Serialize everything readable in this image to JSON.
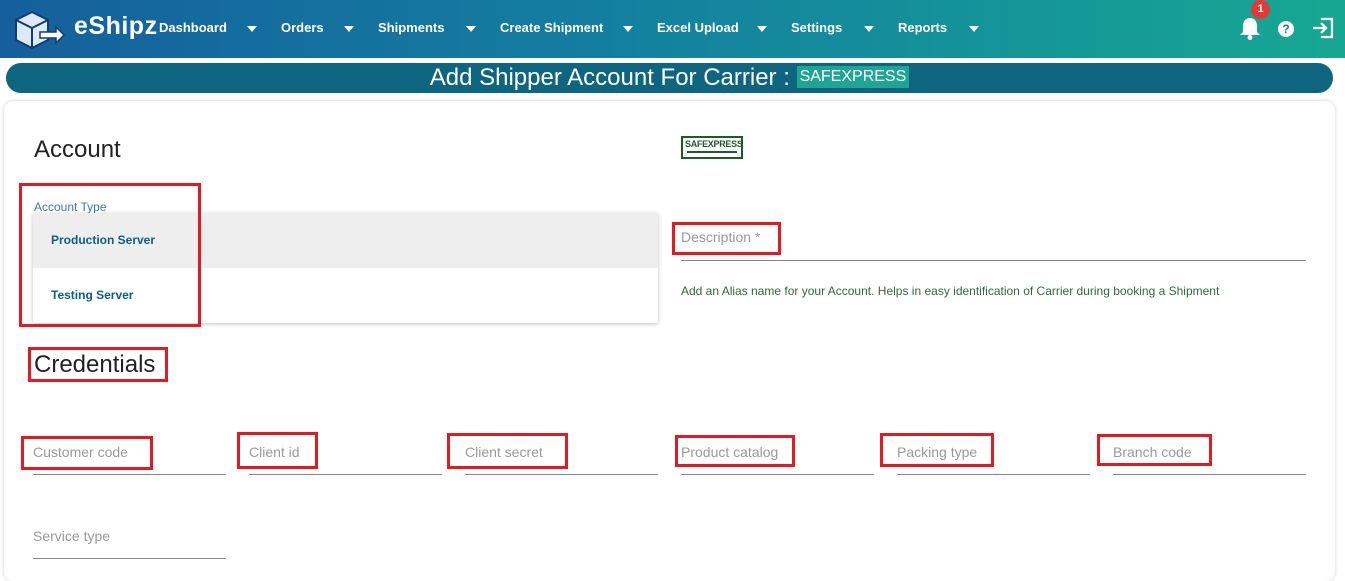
{
  "brand": "eShipz",
  "nav": [
    {
      "label": "Dashboard"
    },
    {
      "label": "Orders"
    },
    {
      "label": "Shipments"
    },
    {
      "label": "Create Shipment"
    },
    {
      "label": "Excel Upload"
    },
    {
      "label": "Settings"
    },
    {
      "label": "Reports"
    }
  ],
  "notifications": {
    "count": "1"
  },
  "help_glyph": "?",
  "page": {
    "title": "Add Shipper Account For Carrier :",
    "carrier": "SAFEXPRESS"
  },
  "account": {
    "heading": "Account",
    "type_label": "Account Type",
    "options": [
      "Production Server",
      "Testing Server"
    ],
    "selected": "Production Server"
  },
  "carrier_logo_text": "SAFEXPRESS",
  "description": {
    "placeholder": "Description *",
    "hint": "Add an Alias name for your Account. Helps in easy identification of Carrier during booking a Shipment"
  },
  "credentials": {
    "heading": "Credentials",
    "fields": [
      {
        "placeholder": "Customer code"
      },
      {
        "placeholder": "Client id"
      },
      {
        "placeholder": "Client secret"
      },
      {
        "placeholder": "Product catalog"
      },
      {
        "placeholder": "Packing type"
      },
      {
        "placeholder": "Branch code"
      },
      {
        "placeholder": "Service type"
      }
    ]
  },
  "colors": {
    "header_start": "#155f9c",
    "header_end": "#16a792",
    "title_bar": "#0e6580",
    "carrier_tag": "#1fa595",
    "annotation": "#e21b23"
  },
  "icons": [
    "app-logo-icon",
    "chevron-down-icon",
    "bell-icon",
    "help-icon",
    "logout-icon"
  ]
}
